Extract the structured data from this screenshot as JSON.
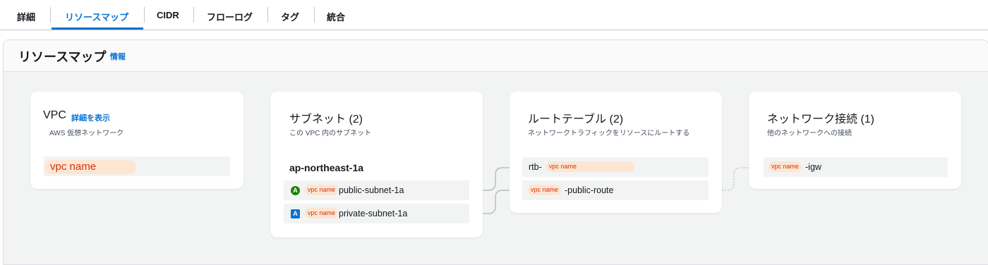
{
  "tabs": [
    {
      "label": "詳細"
    },
    {
      "label": "リソースマップ",
      "active": true
    },
    {
      "label": "CIDR"
    },
    {
      "label": "フローログ"
    },
    {
      "label": "タグ"
    },
    {
      "label": "統合"
    }
  ],
  "panel": {
    "title": "リソースマップ",
    "info": "情報"
  },
  "vpc": {
    "title": "VPC",
    "link": "詳細を表示",
    "desc": "AWS 仮想ネットワーク",
    "name": "vpc name"
  },
  "subnets": {
    "title": "サブネット (2)",
    "desc": "この VPC 内のサブネット",
    "az": "ap-northeast-1a",
    "items": [
      {
        "badge": "A",
        "tag": "vpc name",
        "name": "public-subnet-1a"
      },
      {
        "badge": "A",
        "tag": "vpc name",
        "name": "private-subnet-1a"
      }
    ]
  },
  "route_tables": {
    "title": "ルートテーブル (2)",
    "desc": "ネットワークトラフィックをリソースにルートする",
    "items": [
      {
        "prefix": "rtb-",
        "tag": "vpc name",
        "suffix": ""
      },
      {
        "prefix": "",
        "tag": "vpc name",
        "suffix": "-public-route"
      }
    ]
  },
  "network": {
    "title": "ネットワーク接続 (1)",
    "desc": "他のネットワークへの接続",
    "items": [
      {
        "tag": "vpc name",
        "suffix": "-igw"
      }
    ]
  },
  "colors": {
    "accent": "#0972d3",
    "tag_bg": "#fce6d2",
    "tag_text": "#d13212",
    "public_badge": "#1d8102",
    "private_badge": "#0972d3"
  }
}
